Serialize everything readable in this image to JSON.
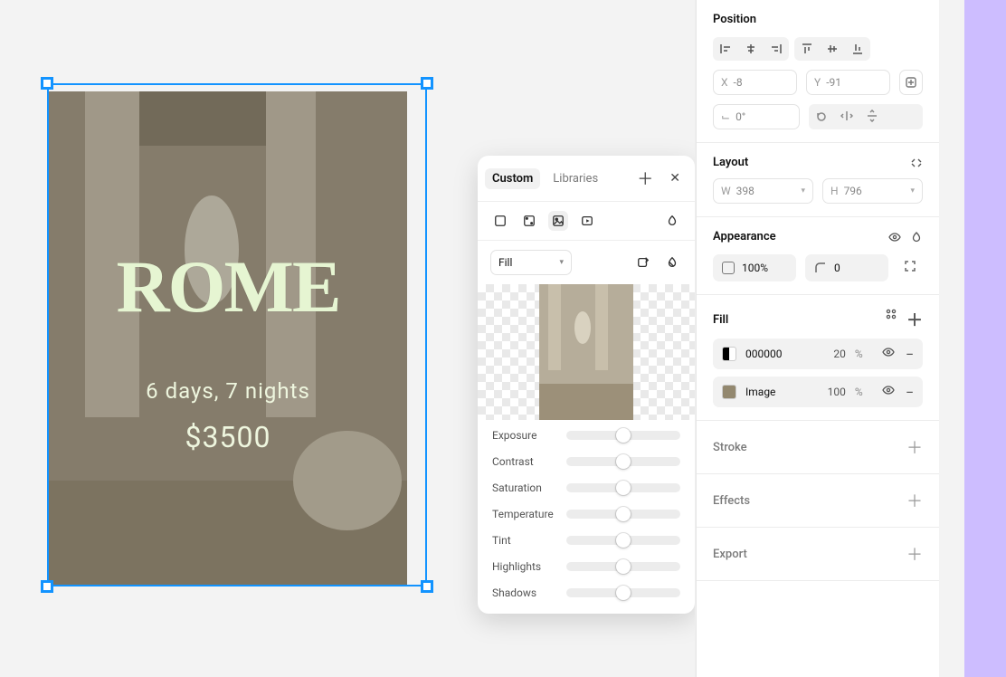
{
  "canvas": {
    "title": "ROME",
    "subtitle": "6 days, 7 nights",
    "price": "$3500"
  },
  "popover": {
    "tabs": {
      "custom": "Custom",
      "libraries": "Libraries"
    },
    "fill_mode": "Fill",
    "sliders": {
      "exposure": "Exposure",
      "contrast": "Contrast",
      "saturation": "Saturation",
      "temperature": "Temperature",
      "tint": "Tint",
      "highlights": "Highlights",
      "shadows": "Shadows"
    }
  },
  "inspector": {
    "position": {
      "title": "Position",
      "x_label": "X",
      "x_value": "-8",
      "y_label": "Y",
      "y_value": "-91",
      "rot_label": "⟀",
      "rot_value": "0°"
    },
    "layout": {
      "title": "Layout",
      "w_label": "W",
      "w_value": "398",
      "h_label": "H",
      "h_value": "796"
    },
    "appearance": {
      "title": "Appearance",
      "opacity": "100%",
      "radius": "0"
    },
    "fill": {
      "title": "Fill",
      "rows": [
        {
          "swatch": "color",
          "label": "000000",
          "pct": "20",
          "unit": "%"
        },
        {
          "swatch": "image",
          "label": "Image",
          "pct": "100",
          "unit": "%"
        }
      ]
    },
    "stroke": {
      "title": "Stroke"
    },
    "effects": {
      "title": "Effects"
    },
    "export": {
      "title": "Export"
    }
  }
}
